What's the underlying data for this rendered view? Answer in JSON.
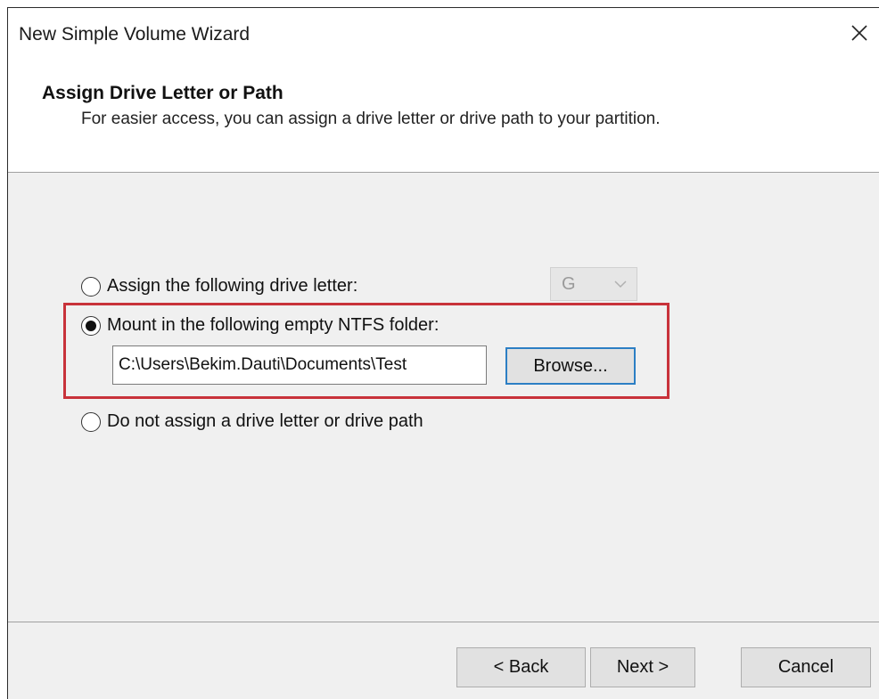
{
  "window": {
    "title": "New Simple Volume Wizard",
    "close_icon": "close-icon"
  },
  "header": {
    "title": "Assign Drive Letter or Path",
    "subtitle": "For easier access, you can assign a drive letter or drive path to your partition."
  },
  "options": {
    "assign_letter": {
      "label": "Assign the following drive letter:",
      "selected": false,
      "drive_letter": "G",
      "enabled": false
    },
    "mount_folder": {
      "label": "Mount in the following empty NTFS folder:",
      "selected": true,
      "path_value": "C:\\Users\\Bekim.Dauti\\Documents\\Test",
      "browse_label": "Browse..."
    },
    "no_assign": {
      "label": "Do not assign a drive letter or drive path",
      "selected": false
    }
  },
  "footer": {
    "back_label": "< Back",
    "next_label": "Next >",
    "cancel_label": "Cancel"
  },
  "colors": {
    "highlight": "#c8323a",
    "focus_border": "#2c7fc4",
    "dialog_bg": "#f0f0f0"
  }
}
